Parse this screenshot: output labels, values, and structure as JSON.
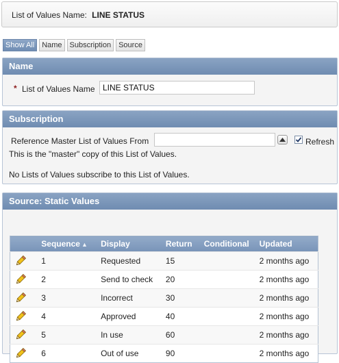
{
  "header": {
    "label": "List of Values Name:",
    "value": "LINE STATUS"
  },
  "tabs": [
    {
      "label": "Show All",
      "active": true
    },
    {
      "label": "Name",
      "active": false
    },
    {
      "label": "Subscription",
      "active": false
    },
    {
      "label": "Source",
      "active": false
    }
  ],
  "name_region": {
    "title": "Name",
    "required_mark": "*",
    "field_label": "List of Values Name",
    "field_value": "LINE STATUS"
  },
  "subscription_region": {
    "title": "Subscription",
    "ref_label": "Reference Master List of Values From",
    "ref_value": "",
    "refresh_label": "Refresh",
    "refresh_checked": true,
    "master_note": "This is the \"master\" copy of this List of Values.",
    "subscribers_note": "No Lists of Values subscribe to this List of Values."
  },
  "source_region": {
    "title": "Source: Static Values",
    "columns": [
      "Sequence",
      "Display",
      "Return",
      "Conditional",
      "Updated"
    ],
    "sort_indicator": "▲",
    "rows": [
      {
        "sequence": "1",
        "display": "Requested",
        "return": "15",
        "conditional": "",
        "updated": "2 months ago"
      },
      {
        "sequence": "2",
        "display": "Send to check",
        "return": "20",
        "conditional": "",
        "updated": "2 months ago"
      },
      {
        "sequence": "3",
        "display": "Incorrect",
        "return": "30",
        "conditional": "",
        "updated": "2 months ago"
      },
      {
        "sequence": "4",
        "display": "Approved",
        "return": "40",
        "conditional": "",
        "updated": "2 months ago"
      },
      {
        "sequence": "5",
        "display": "In use",
        "return": "60",
        "conditional": "",
        "updated": "2 months ago"
      },
      {
        "sequence": "6",
        "display": "Out of use",
        "return": "90",
        "conditional": "",
        "updated": "2 months ago"
      }
    ]
  },
  "icons": {
    "edit": "pencil-icon",
    "lov": "triangle-up-icon",
    "check": "checkmark-icon"
  },
  "colors": {
    "header_blue": "#7893b8",
    "required_red": "#8b1c1c",
    "pencil_yellow": "#f2c21b"
  }
}
